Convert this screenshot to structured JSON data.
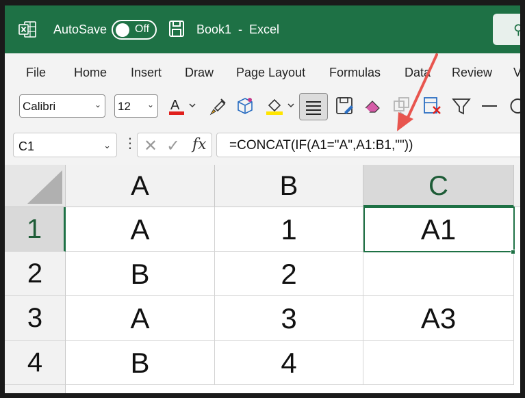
{
  "title_bar": {
    "autosave_label": "AutoSave",
    "autosave_state": "Off",
    "document_title": "Book1  -  Excel",
    "brand_color": "#1e7145"
  },
  "menu": {
    "items": [
      "File",
      "Home",
      "Insert",
      "Draw",
      "Page Layout",
      "Formulas",
      "Data",
      "Review",
      "View"
    ]
  },
  "ribbon": {
    "font_name": "Calibri",
    "font_size": "12",
    "font_color": "#e0201c",
    "icons": [
      "font-color-icon",
      "format-painter-icon",
      "cube-icon",
      "fill-color-icon",
      "align-center-icon",
      "save-as-icon",
      "eraser-icon",
      "copy-icon",
      "clear-icon",
      "filter-icon",
      "line-icon",
      "rotate-icon"
    ]
  },
  "formula_bar": {
    "name_box": "C1",
    "fx_label": "fx",
    "formula": "=CONCAT(IF(A1=\"A\",A1:B1,\"\"))"
  },
  "sheet": {
    "columns": [
      "A",
      "B",
      "C"
    ],
    "selected_column": "C",
    "rows": [
      {
        "row": "1",
        "cells": [
          "A",
          "1",
          "A1"
        ]
      },
      {
        "row": "2",
        "cells": [
          "B",
          "2",
          ""
        ]
      },
      {
        "row": "3",
        "cells": [
          "A",
          "3",
          "A3"
        ]
      },
      {
        "row": "4",
        "cells": [
          "B",
          "4",
          ""
        ]
      }
    ],
    "selected_row": "1",
    "active_cell": "C1"
  },
  "annotation": {
    "arrow_color": "#e8554e"
  }
}
